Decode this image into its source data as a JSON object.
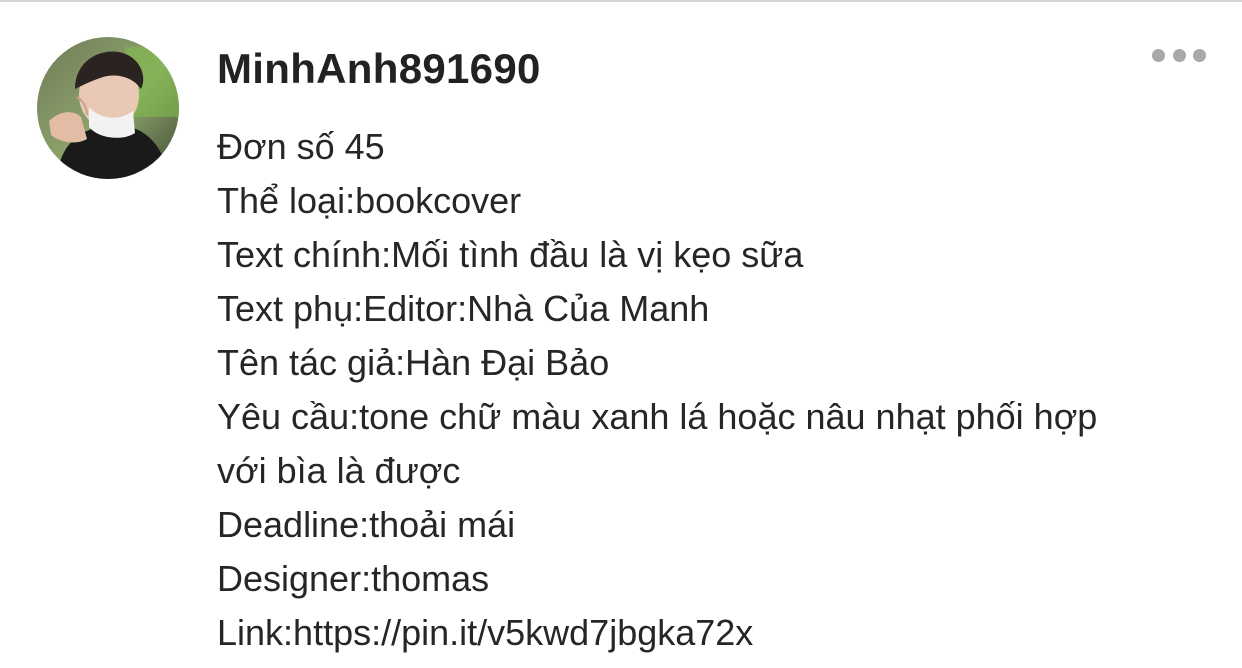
{
  "post": {
    "author": {
      "username": "MinhAnh891690",
      "avatar_icon": "user-avatar-photo"
    },
    "menu_icon": "more-horizontal-icon",
    "content_lines": [
      "Đơn số 45",
      "Thể loại:bookcover",
      "Text chính:Mối tình đầu là vị kẹo sữa",
      "Text phụ:Editor:Nhà Của Manh",
      "Tên tác giả:Hàn Đại Bảo",
      "Yêu cầu:tone chữ màu xanh lá hoặc nâu nhạt phối hợp",
      "với bìa là được",
      "Deadline:thoải mái",
      "Designer:thomas",
      "Link:https://pin.it/v5kwd7jbgka72x"
    ]
  },
  "colors": {
    "divider": "#d6d6d6",
    "text": "#262626",
    "menu_dots": "#a9a9a9"
  }
}
